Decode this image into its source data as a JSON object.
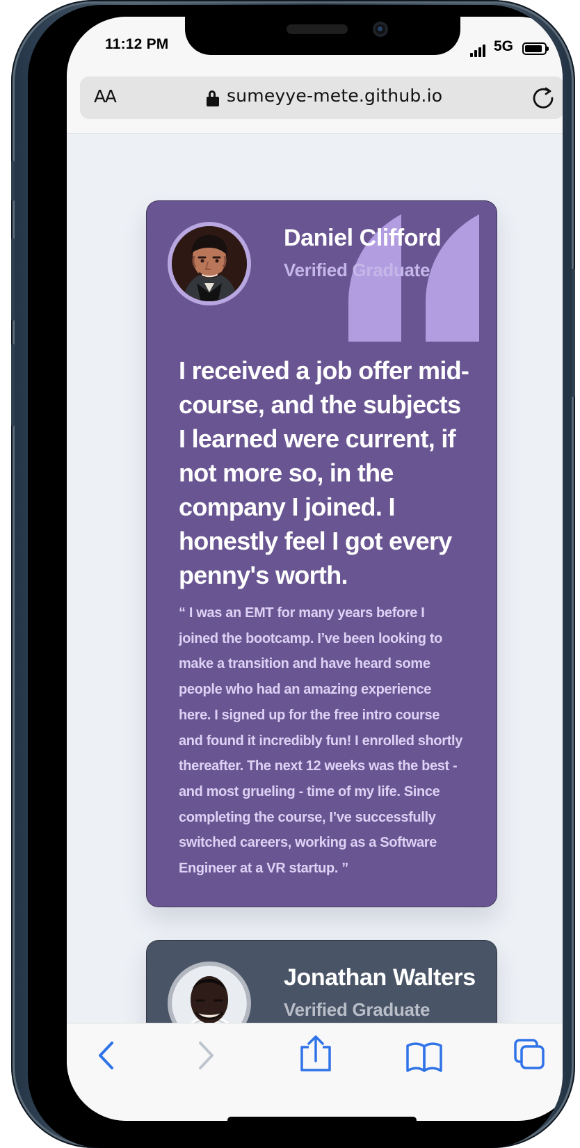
{
  "status_bar": {
    "time": "11:12 PM",
    "network": "5G"
  },
  "browser": {
    "text_size_label": "AA",
    "url": "sumeyye-mete.github.io"
  },
  "testimonials": [
    {
      "name": "Daniel Clifford",
      "role": "Verified Graduate",
      "headline": "I received a job offer mid-course, and the subjects I learned were current, if not more so, in the company I joined. I honestly feel I got every penny's worth.",
      "quote": "“ I was an EMT for many years before I joined the bootcamp. I’ve been looking to make a transition and have heard some people who had an amazing experience here. I signed up for the free intro course and found it incredibly fun! I enrolled shortly thereafter. The next 12 weeks was the best - and most grueling - time of my life. Since completing the course, I’ve successfully switched careers, working as a Software Engineer at a VR startup. ”"
    },
    {
      "name": "Jonathan Walters",
      "role": "Verified Graduate"
    }
  ],
  "colors": {
    "card_purple": "#695592",
    "card_gray": "#495466",
    "quote_mark": "#B29FE0",
    "toolbar_blue": "#2F73E8",
    "page_background": "#EDF1F6"
  },
  "icons": {
    "lock": "lock-icon",
    "reload": "reload-icon",
    "quote": "quote-mark-icon",
    "back": "back-chevron-icon",
    "forward": "forward-chevron-icon",
    "share": "share-icon",
    "bookmarks": "bookmarks-icon",
    "tabs": "tabs-icon"
  }
}
